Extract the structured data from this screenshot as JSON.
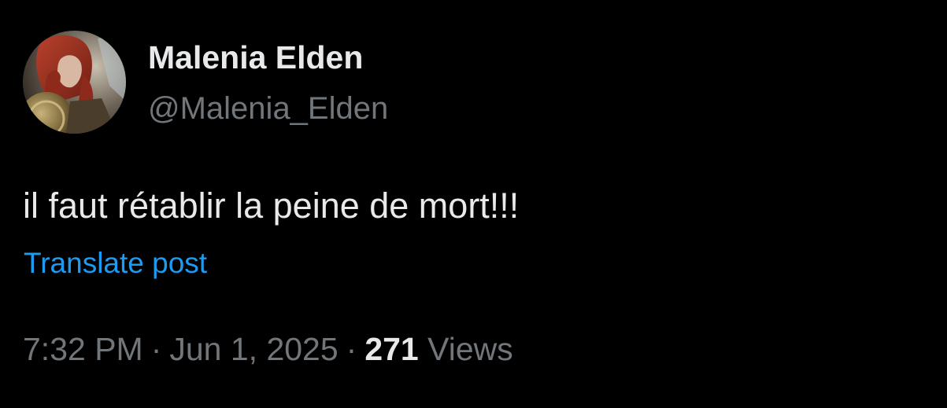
{
  "author": {
    "display_name": "Malenia Elden",
    "handle": "@Malenia_Elden"
  },
  "post": {
    "text": "il faut rétablir la peine de mort!!!",
    "translate_label": "Translate post"
  },
  "meta": {
    "time": "7:32 PM",
    "separator": "·",
    "date": "Jun 1, 2025",
    "views_count": "271",
    "views_label": "Views"
  },
  "colors": {
    "background": "#000000",
    "primary_text": "#e7e9ea",
    "secondary_text": "#71767b",
    "link": "#1d9bf0"
  }
}
